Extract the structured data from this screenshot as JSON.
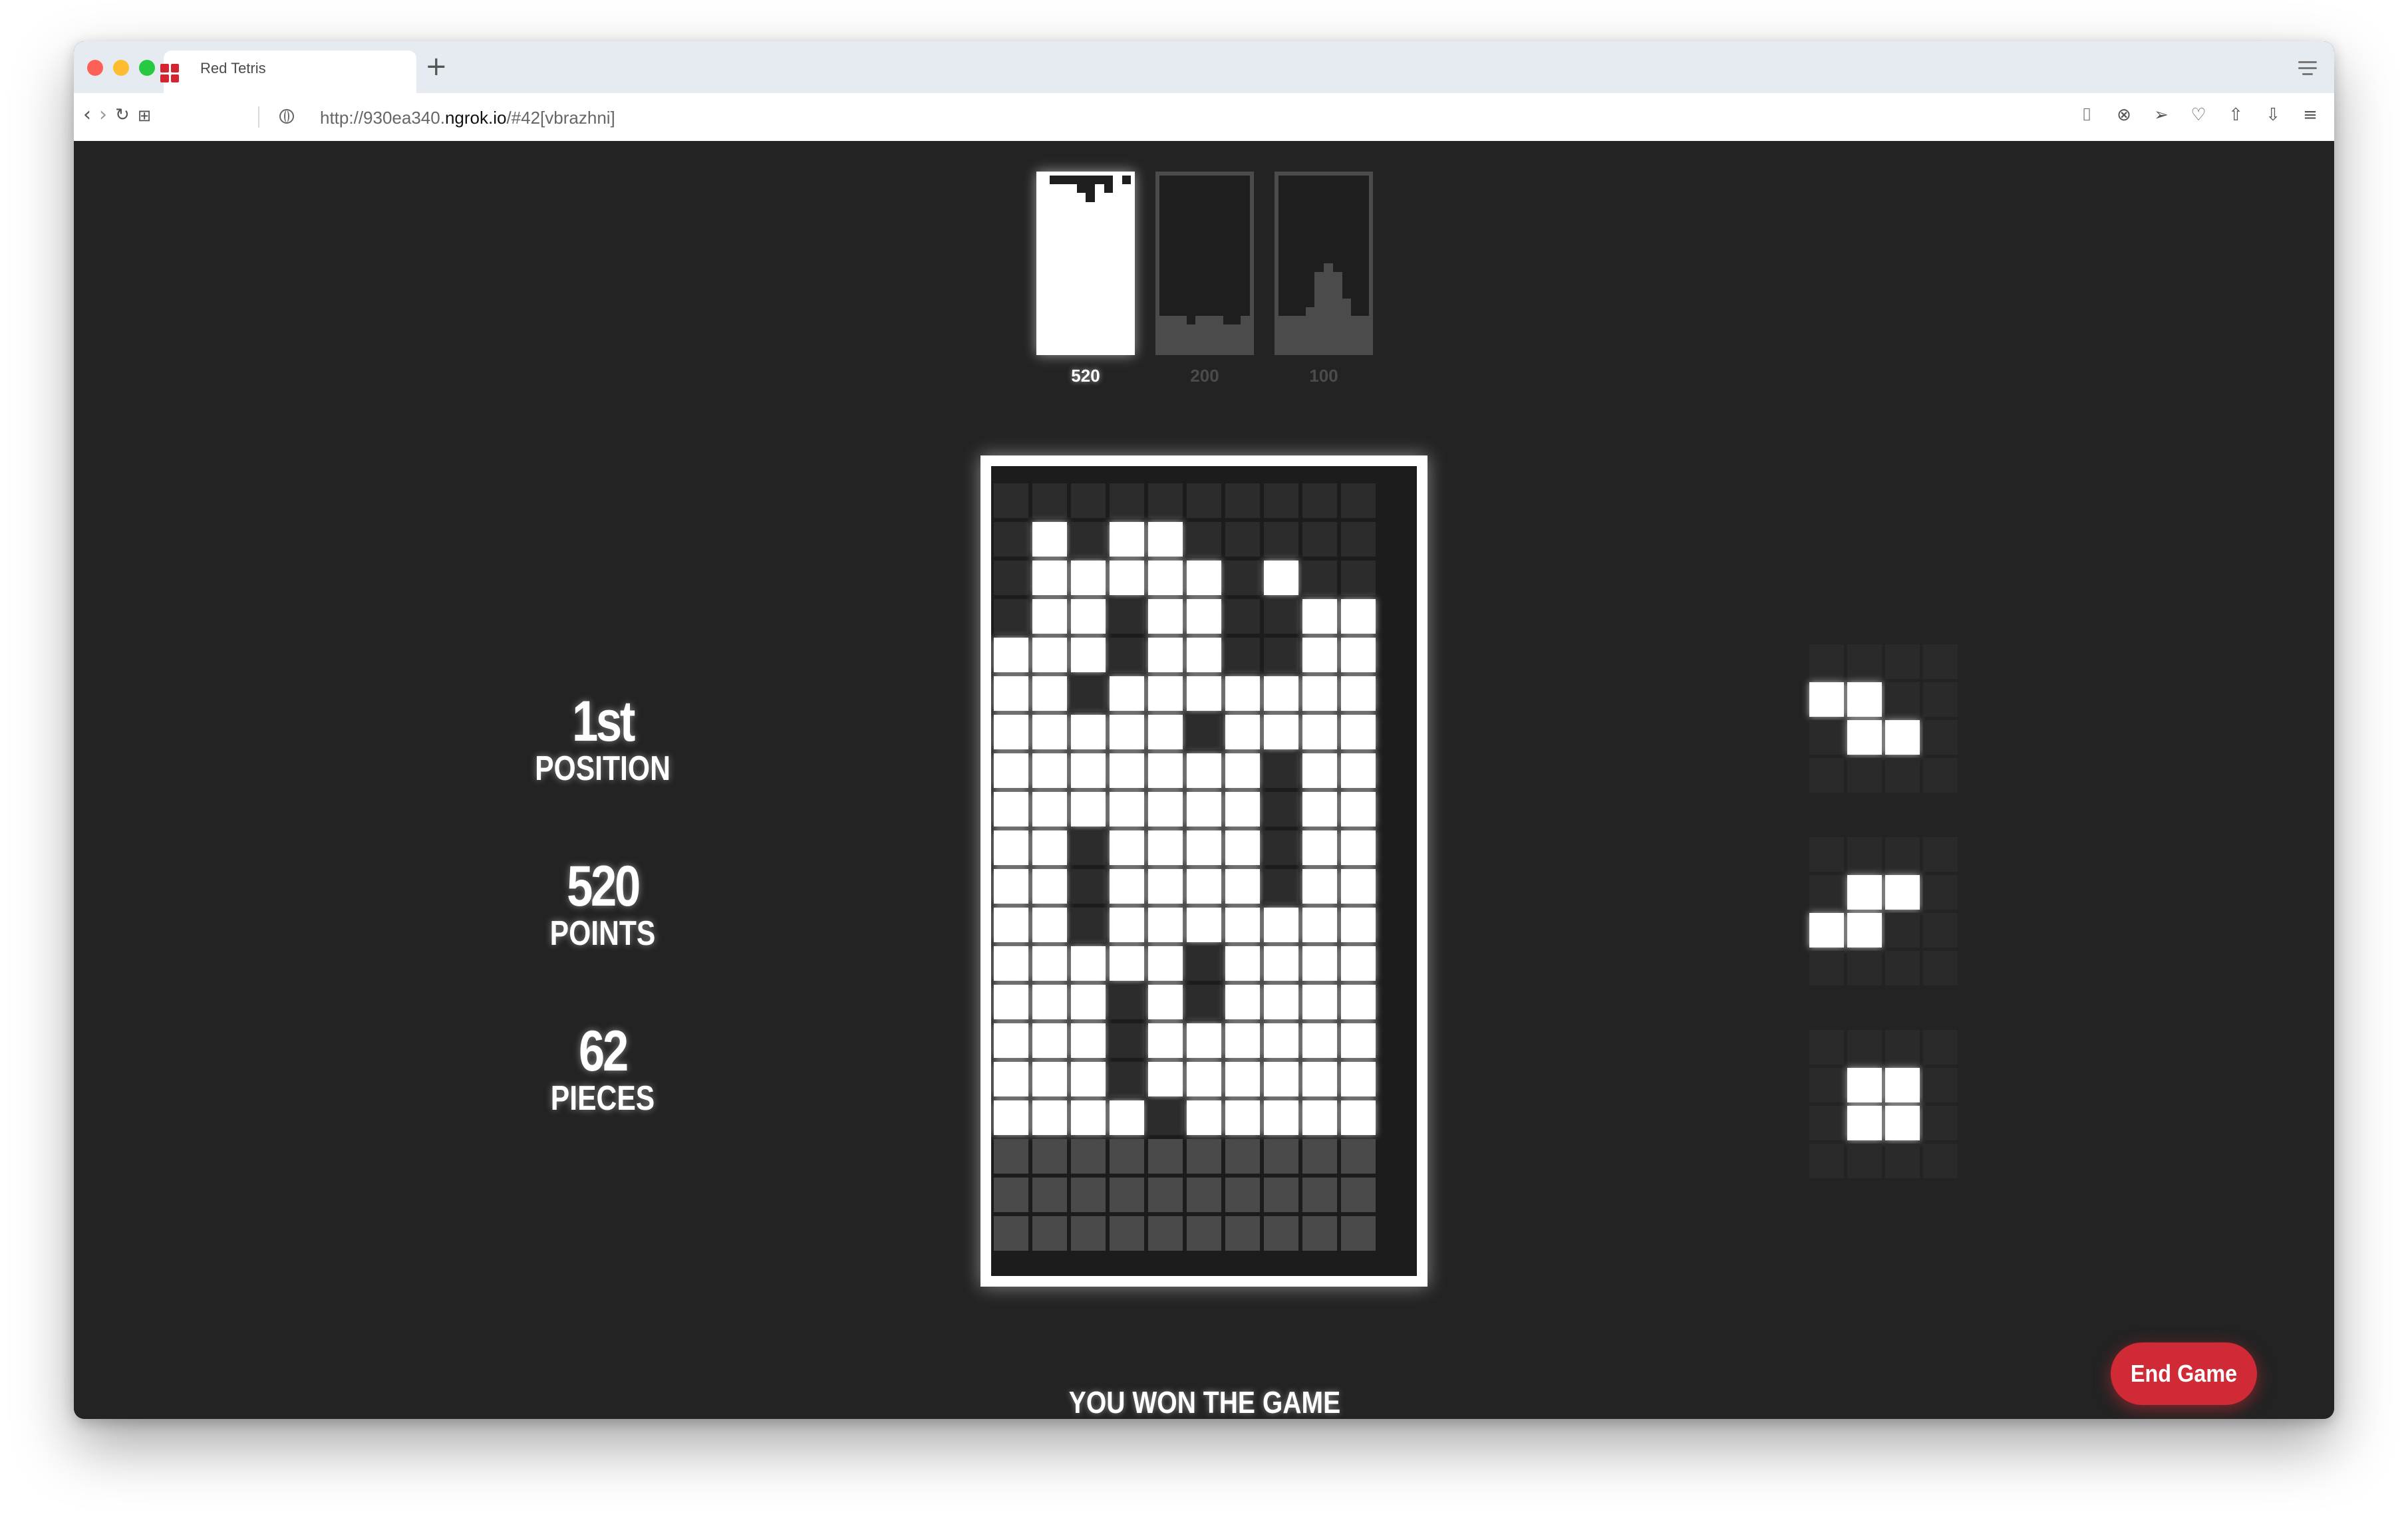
{
  "browser": {
    "tab_title": "Red Tetris",
    "url_prefix": "http://930ea340.",
    "url_host": "ngrok.io",
    "url_suffix": "/#42[vbrazhni]",
    "brand_color": "#d42533"
  },
  "spectrums": [
    {
      "score": "520",
      "active": true,
      "heights": [
        20,
        19,
        19,
        19,
        18,
        17,
        19,
        18,
        20,
        19
      ]
    },
    {
      "score": "200",
      "active": false,
      "heights": [
        4,
        4,
        4,
        3,
        4,
        4,
        4,
        3,
        3,
        4
      ]
    },
    {
      "score": "100",
      "active": false,
      "heights": [
        4,
        4,
        4,
        5,
        9,
        10,
        9,
        6,
        4,
        4
      ]
    }
  ],
  "stats": {
    "position_value": "1st",
    "position_label": "POSITION",
    "points_value": "520",
    "points_label": "POINTS",
    "pieces_value": "62",
    "pieces_label": "PIECES"
  },
  "board": {
    "columns": 10,
    "rows": [
      "..........",
      ".#.##.....",
      ".#####.#..",
      ".##.##..##",
      "###.##..##",
      "##.#######",
      "#####.####",
      "#######.##",
      "#######.##",
      "##.####.##",
      "##.####.##",
      "##.#######",
      "#####.####",
      "###.#.####",
      "###.######",
      "###.######",
      "####.#####",
      "pppppppppp",
      "pppppppppp",
      "pppppppppp"
    ]
  },
  "next_pieces": [
    {
      "rows": [
        "....",
        "##..",
        ".##.",
        "...."
      ]
    },
    {
      "rows": [
        "....",
        ".##.",
        "##..",
        "...."
      ]
    },
    {
      "rows": [
        "....",
        ".##.",
        ".##.",
        "...."
      ]
    }
  ],
  "status_text": "YOU WON THE GAME",
  "end_button_label": "End Game",
  "accent_color": "#cf2a36"
}
